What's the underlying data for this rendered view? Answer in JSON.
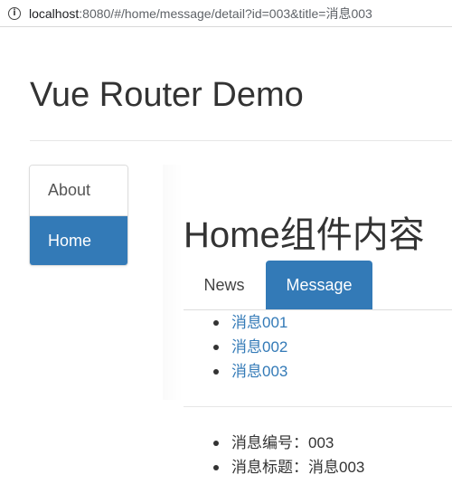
{
  "browser": {
    "url_host": "localhost",
    "url_rest": ":8080/#/home/message/detail?id=003&title=消息003"
  },
  "header": {
    "title": "Vue Router Demo"
  },
  "sidebar": {
    "items": [
      {
        "label": "About",
        "active": false
      },
      {
        "label": "Home",
        "active": true
      }
    ]
  },
  "main": {
    "heading": "Home组件内容",
    "tabs": [
      {
        "label": "News",
        "active": false
      },
      {
        "label": "Message",
        "active": true
      }
    ],
    "messages": [
      {
        "label": "消息001"
      },
      {
        "label": "消息002"
      },
      {
        "label": "消息003"
      }
    ],
    "detail": {
      "id_line": "消息编号：003",
      "title_line": "消息标题：消息003"
    }
  },
  "colors": {
    "accent": "#337ab7",
    "link": "#337ab7",
    "text": "#333333",
    "border": "#dddddd"
  }
}
